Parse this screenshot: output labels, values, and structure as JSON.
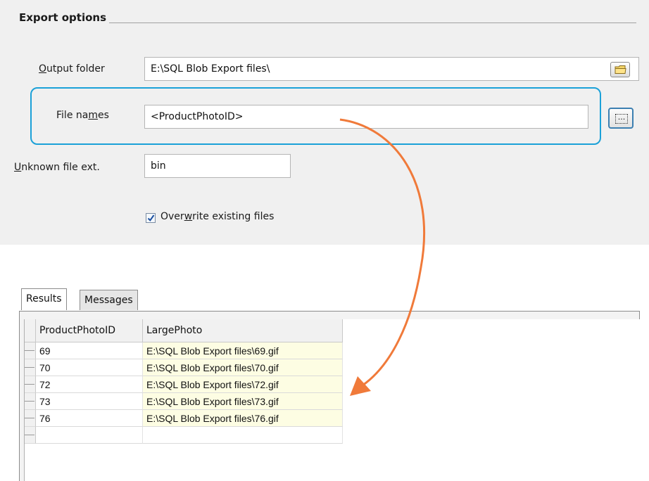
{
  "export_options": {
    "group_title": "Export options",
    "output_folder": {
      "label_ul": "O",
      "label_rest": "utput folder",
      "value": "E:\\SQL Blob Export files\\"
    },
    "file_names": {
      "label_pre": "File na",
      "label_ul": "m",
      "label_post": "es",
      "value": "<ProductPhotoID>"
    },
    "unknown_ext": {
      "label_ul": "U",
      "label_rest": "nknown file ext.",
      "value": "bin"
    },
    "overwrite": {
      "checked": true,
      "label_pre": "Over",
      "label_ul": "w",
      "label_post": "rite existing files"
    },
    "browse_button": "..."
  },
  "results": {
    "tabs": [
      "Results",
      "Messages"
    ],
    "active_tab": "Results",
    "columns": [
      "ProductPhotoID",
      "LargePhoto"
    ],
    "rows": [
      [
        "69",
        "E:\\SQL Blob Export files\\69.gif"
      ],
      [
        "70",
        "E:\\SQL Blob Export files\\70.gif"
      ],
      [
        "72",
        "E:\\SQL Blob Export files\\72.gif"
      ],
      [
        "73",
        "E:\\SQL Blob Export files\\73.gif"
      ],
      [
        "76",
        "E:\\SQL Blob Export files\\76.gif"
      ]
    ]
  },
  "colors": {
    "highlight_border": "#1ba1d8",
    "arrow": "#f07a3a",
    "path_cell_bg": "#fdfde3"
  },
  "icons": {
    "folder_button": "folder-icon",
    "checkbox": "checkmark-icon",
    "arrow": "curved-arrow-icon"
  }
}
